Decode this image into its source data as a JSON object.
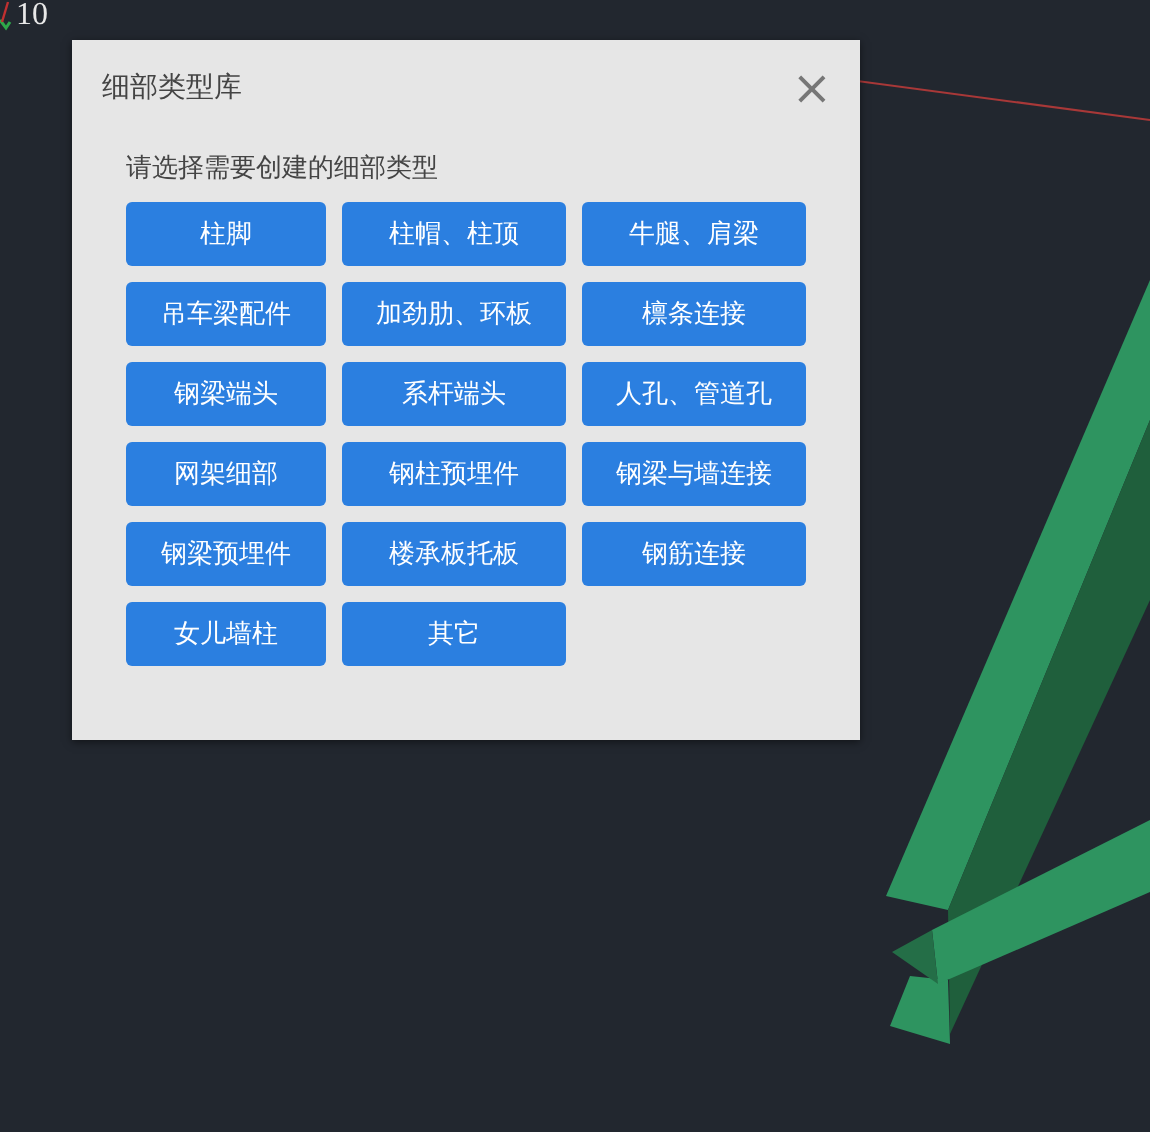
{
  "viewport_label": "10",
  "dialog": {
    "title": "细部类型库",
    "close": "×",
    "prompt": "请选择需要创建的细部类型",
    "buttons": [
      "柱脚",
      "柱帽、柱顶",
      "牛腿、肩梁",
      "吊车梁配件",
      "加劲肋、环板",
      "檩条连接",
      "钢梁端头",
      "系杆端头",
      "人孔、管道孔",
      "网架细部",
      "钢柱预埋件",
      "钢梁与墙连接",
      "钢梁预埋件",
      "楼承板托板",
      "钢筋连接",
      "女儿墙柱",
      "其它"
    ]
  }
}
